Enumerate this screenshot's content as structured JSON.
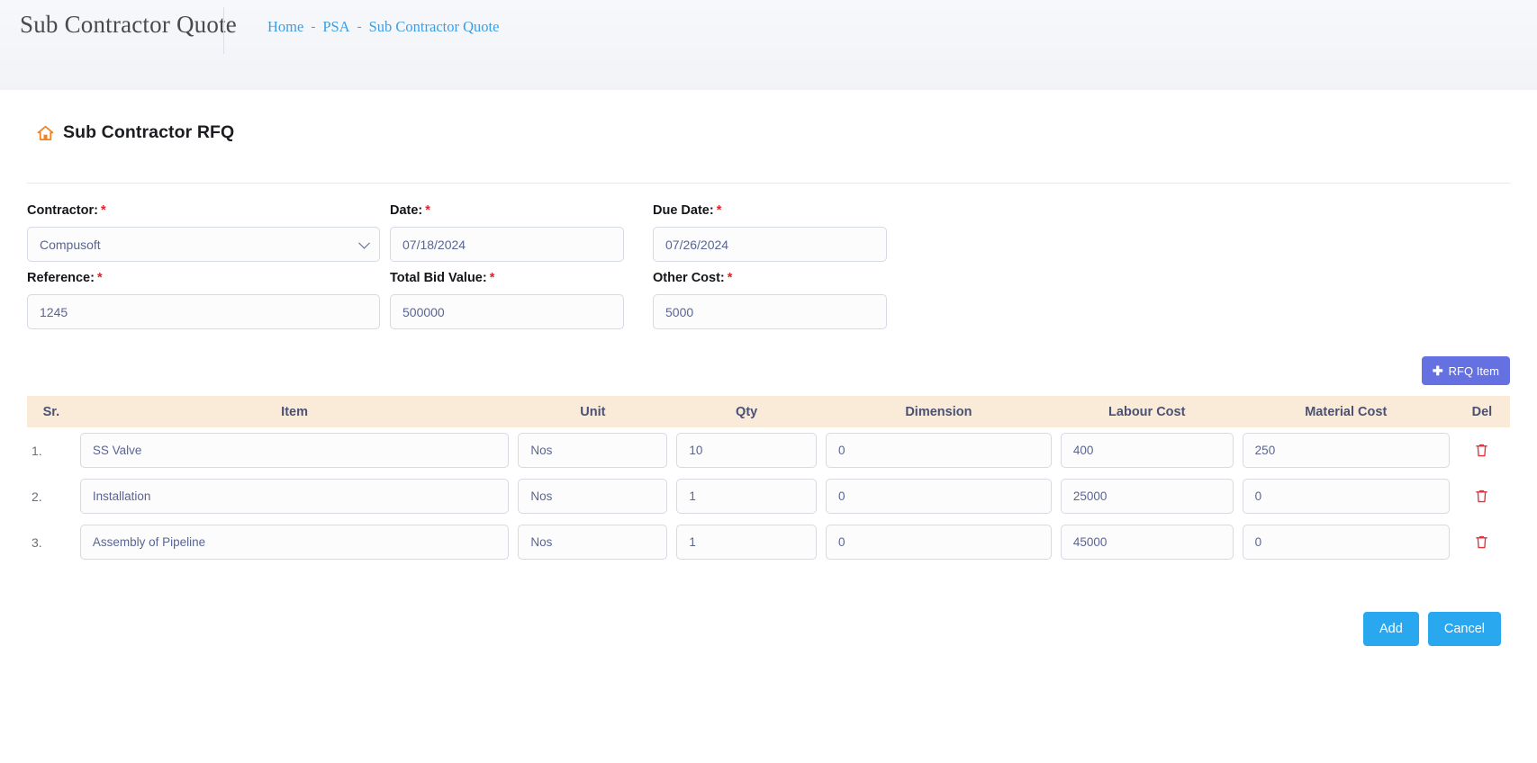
{
  "header": {
    "title": "Sub Contractor Quote",
    "breadcrumb": [
      {
        "label": "Home",
        "sep": "-"
      },
      {
        "label": "PSA",
        "sep": "-"
      },
      {
        "label": "Sub Contractor Quote",
        "sep": ""
      }
    ]
  },
  "card": {
    "icon": "home-icon",
    "title": "Sub Contractor RFQ"
  },
  "form": {
    "contractor": {
      "label": "Contractor:",
      "required": "*",
      "value": "Compusoft",
      "icon": "chevron-down-icon"
    },
    "date": {
      "label": "Date:",
      "required": "*",
      "value": "07/18/2024"
    },
    "due_date": {
      "label": "Due Date:",
      "required": "*",
      "value": "07/26/2024"
    },
    "reference": {
      "label": "Reference:",
      "required": "*",
      "value": "1245"
    },
    "total_bid_value": {
      "label": "Total Bid Value:",
      "required": "*",
      "value": "500000"
    },
    "other_cost": {
      "label": "Other Cost:",
      "required": "*",
      "value": "5000"
    }
  },
  "toolbar": {
    "add_item_label": "RFQ Item",
    "add_item_plus": "✚",
    "add_item_color": "#6571e0"
  },
  "table": {
    "header_bg": "#faead8",
    "columns": [
      "Sr.",
      "Item",
      "Unit",
      "Qty",
      "Dimension",
      "Labour Cost",
      "Material Cost",
      "Del"
    ],
    "rows": [
      {
        "sr": "1.",
        "item": "SS Valve",
        "unit": "Nos",
        "qty": "10",
        "dimension": "0",
        "labour_cost": "400",
        "material_cost": "250",
        "del_icon": "trash-icon"
      },
      {
        "sr": "2.",
        "item": "Installation",
        "unit": "Nos",
        "qty": "1",
        "dimension": "0",
        "labour_cost": "25000",
        "material_cost": "0",
        "del_icon": "trash-icon"
      },
      {
        "sr": "3.",
        "item": "Assembly of Pipeline",
        "unit": "Nos",
        "qty": "1",
        "dimension": "0",
        "labour_cost": "45000",
        "material_cost": "0",
        "del_icon": "trash-icon"
      }
    ]
  },
  "footer": {
    "add_label": "Add",
    "cancel_label": "Cancel",
    "button_color": "#29a7ef"
  }
}
